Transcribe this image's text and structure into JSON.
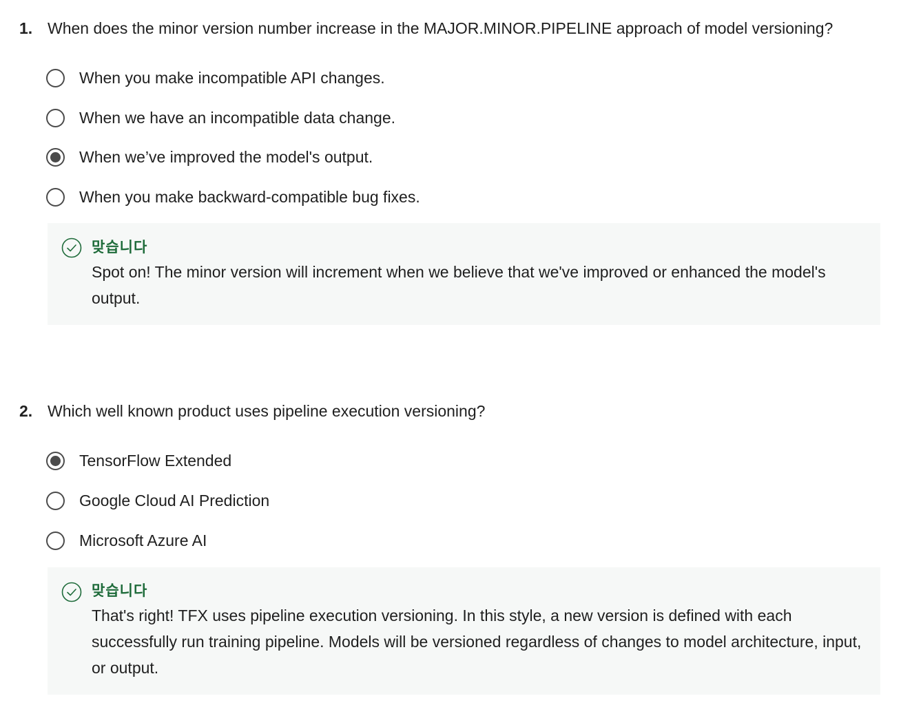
{
  "questions": [
    {
      "number": "1.",
      "text": "When does the minor version number increase in the MAJOR.MINOR.PIPELINE approach of model versioning?",
      "options": [
        {
          "label": "When you make incompatible API changes.",
          "selected": false
        },
        {
          "label": "When we have an incompatible data change.",
          "selected": false
        },
        {
          "label": "When we’ve improved the model's output.",
          "selected": true
        },
        {
          "label": "When you make backward-compatible bug fixes.",
          "selected": false
        }
      ],
      "feedback": {
        "status": "맞습니다",
        "text": "Spot on! The minor version will increment when we believe that we've improved or enhanced the model's output."
      }
    },
    {
      "number": "2.",
      "text": "Which well known product uses pipeline execution versioning?",
      "options": [
        {
          "label": "TensorFlow Extended",
          "selected": true
        },
        {
          "label": "Google Cloud AI Prediction",
          "selected": false
        },
        {
          "label": "Microsoft Azure AI",
          "selected": false
        }
      ],
      "feedback": {
        "status": "맞습니다",
        "text": "That's right! TFX uses pipeline execution versioning. In this style, a new version is defined with each successfully run training pipeline. Models will be versioned regardless of changes to model architecture, input, or output."
      }
    }
  ],
  "colors": {
    "correct": "#1e6b3a",
    "feedback_bg": "#f6f8f7",
    "radio": "#4a4a4a"
  },
  "icons": {
    "feedback": "check-circle-icon"
  }
}
